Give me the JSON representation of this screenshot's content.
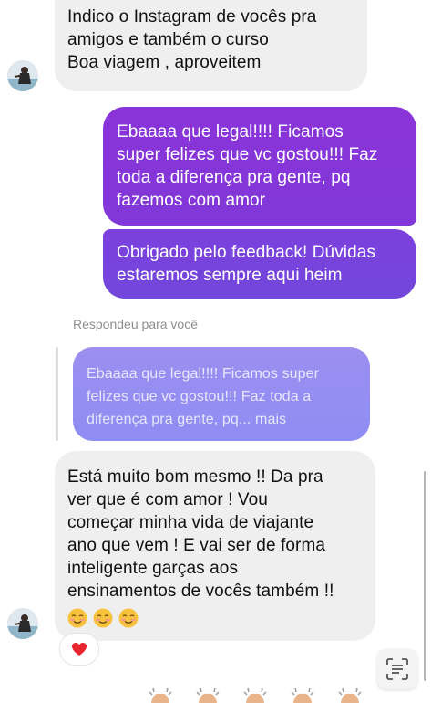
{
  "thread": {
    "in_msg_1": {
      "lines": [
        "Indico o Instagram de vocês pra",
        "amigos e também o curso",
        "Boa viagem , aproveitem"
      ]
    },
    "out_msg_1": {
      "lines": [
        "Ebaaaa que legal!!!! Ficamos",
        "super felizes que vc gostou!!! Faz",
        "toda a diferença pra gente, pq",
        "fazemos com amor"
      ]
    },
    "out_msg_2": {
      "lines": [
        "Obrigado pelo feedback! Dúvidas",
        "estaremos sempre aqui heim"
      ]
    },
    "reply_label": "Respondeu para você",
    "quoted_msg": {
      "lines": [
        "Ebaaaa que legal!!!! Ficamos super",
        "felizes que vc gostou!!! Faz toda a",
        "diferença pra gente, pq... mais"
      ]
    },
    "in_msg_2": {
      "lines": [
        "Está muito bom mesmo !! Da pra",
        "ver que é com amor ! Vou",
        "começar minha vida de viajante",
        "ano que vem ! E vai ser de forma",
        "inteligente garças aos",
        "ensinamentos de vocês também !!"
      ],
      "emojis": [
        "smiling-face-with-blush-icon",
        "smiling-face-with-blush-icon",
        "smiling-face-with-blush-icon"
      ]
    },
    "reaction": "heart-icon"
  },
  "colors": {
    "incoming_bubble": "#efefef",
    "outgoing_purple": "#8a33d8",
    "outgoing_violet": "#7247dc",
    "quoted_bubble": "#9c8ff0",
    "reaction_heart": "#e8242e"
  }
}
